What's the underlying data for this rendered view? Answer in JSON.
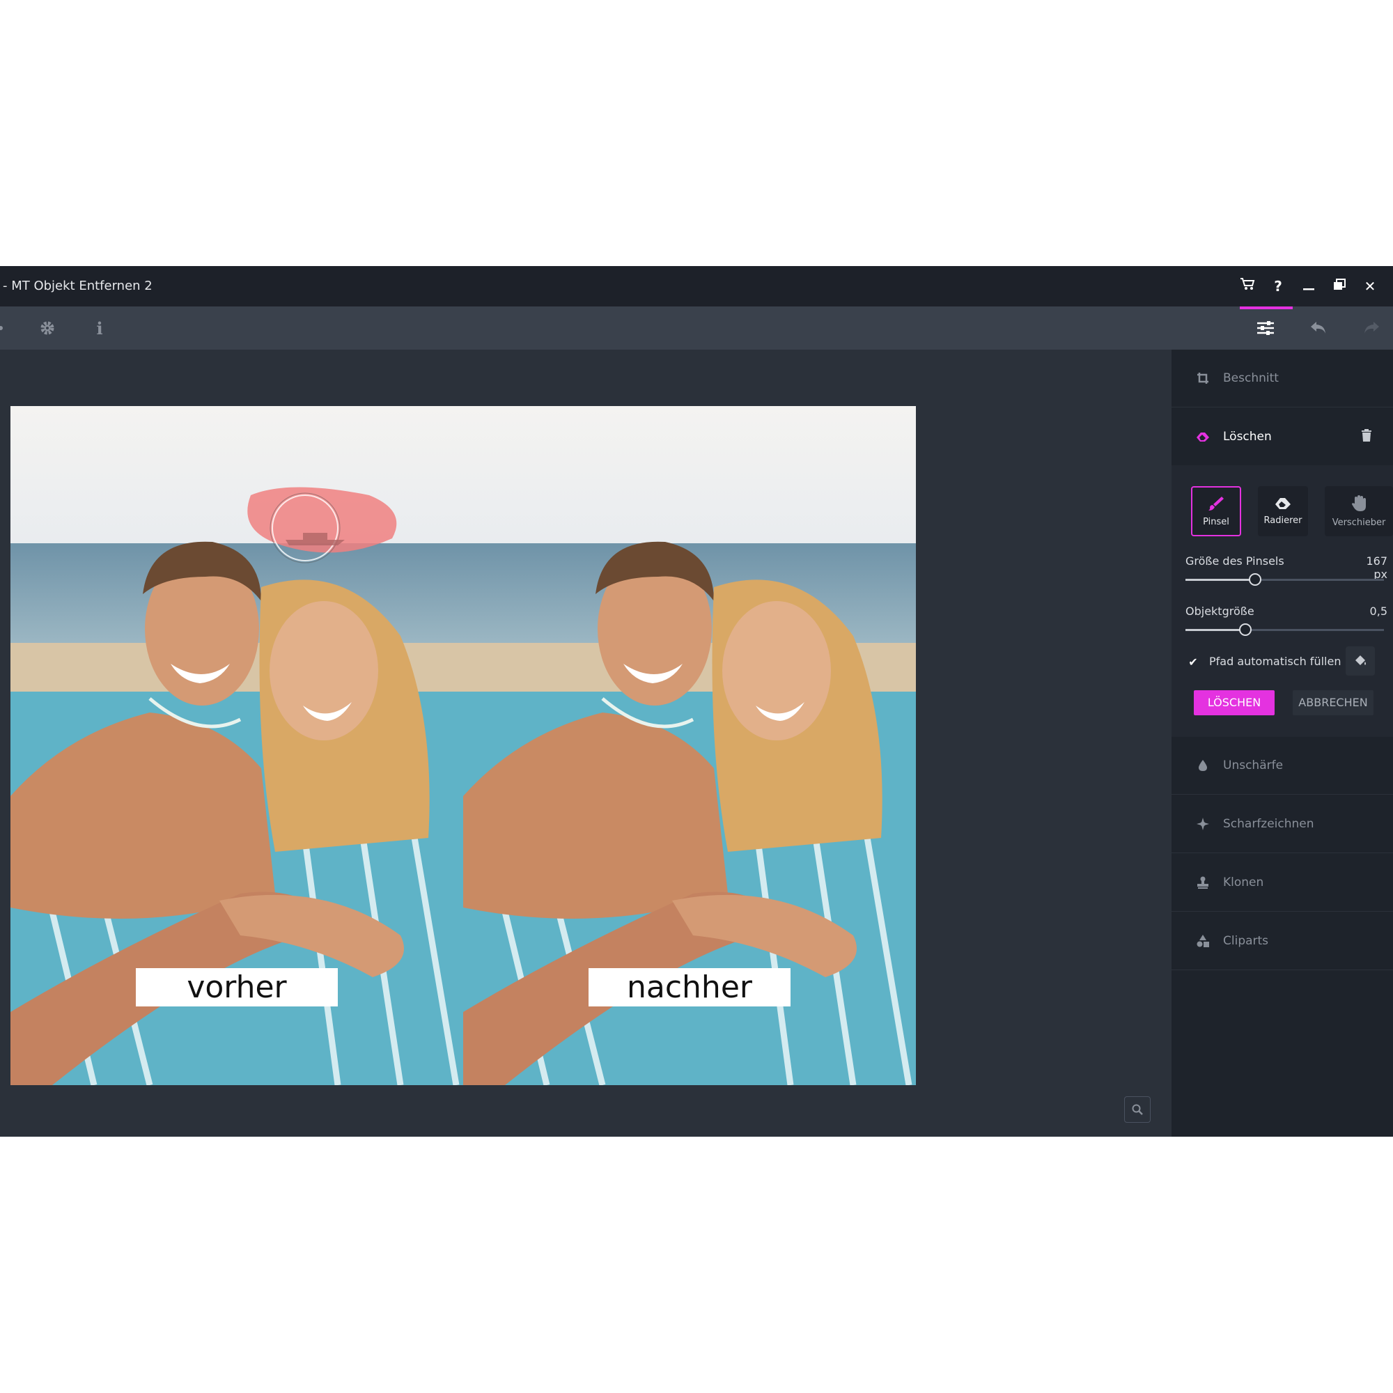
{
  "window": {
    "title": "- MT Objekt Entfernen 2",
    "controls": [
      "cart-icon",
      "help-icon",
      "minimize-icon",
      "restore-icon",
      "close-icon"
    ],
    "help_glyph": "?",
    "close_glyph": "✕"
  },
  "toolbar": {
    "left_icons": [
      "gear-icon",
      "info-icon"
    ],
    "info_glyph": "i",
    "right_icons": [
      "sliders-icon",
      "undo-icon",
      "redo-icon"
    ]
  },
  "canvas": {
    "captions": {
      "before": "vorher",
      "after": "nachher"
    }
  },
  "panel": {
    "sections": {
      "beschnitt": "Beschnitt",
      "loeschen": "Löschen",
      "unschaerfe": "Unschärfe",
      "scharfzeichnen": "Scharfzeichnen",
      "klonen": "Klonen",
      "cliparts": "Cliparts"
    },
    "tools": {
      "pinsel": "Pinsel",
      "radierer": "Radierer",
      "verschieber": "Verschieber"
    },
    "brush_size": {
      "label": "Größe des Pinsels",
      "value": "167 px",
      "level": 0.35
    },
    "object_size": {
      "label": "Objektgröße",
      "value": "0,5",
      "level": 0.3
    },
    "autofill": {
      "label": "Pfad automatisch füllen",
      "checked": true
    },
    "buttons": {
      "delete": "LÖSCHEN",
      "cancel": "ABBRECHEN"
    }
  },
  "colors": {
    "accent": "#e432e0",
    "titlebar": "#1d2129",
    "toolbar": "#3a414c",
    "panel": "#1e232b",
    "canvas": "#2b313a",
    "mask": "#f08080"
  }
}
